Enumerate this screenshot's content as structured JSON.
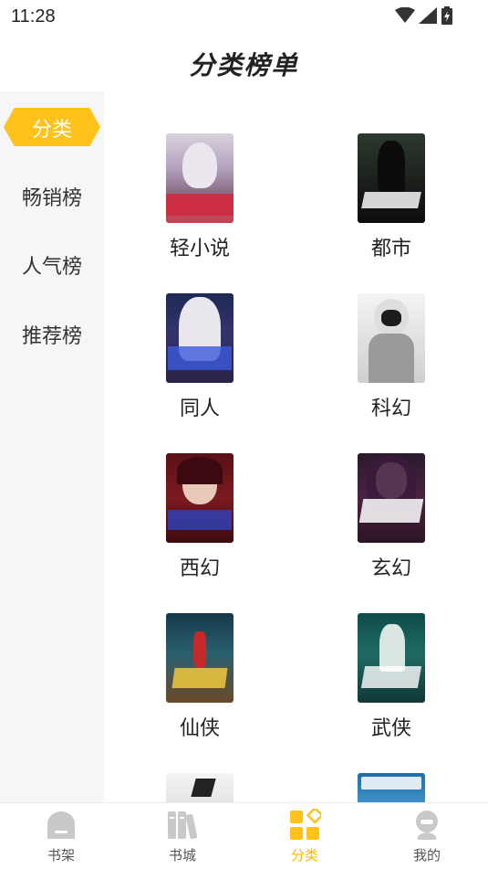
{
  "status": {
    "time": "11:28"
  },
  "header": {
    "title": "分类榜单"
  },
  "sidebar": {
    "items": [
      {
        "label": "分类",
        "active": true
      },
      {
        "label": "畅销榜",
        "active": false
      },
      {
        "label": "人气榜",
        "active": false
      },
      {
        "label": "推荐榜",
        "active": false
      }
    ]
  },
  "categories": [
    {
      "name": "轻小说",
      "cover": "anime-girl-cover"
    },
    {
      "name": "都市",
      "cover": "dark-warrior-cover"
    },
    {
      "name": "同人",
      "cover": "white-hair-girl-cover"
    },
    {
      "name": "科幻",
      "cover": "masked-figure-cover"
    },
    {
      "name": "西幻",
      "cover": "red-hair-girl-cover"
    },
    {
      "name": "玄幻",
      "cover": "purple-hair-girl-cover"
    },
    {
      "name": "仙侠",
      "cover": "mountain-hero-cover"
    },
    {
      "name": "武侠",
      "cover": "swordsman-cover"
    },
    {
      "name": "",
      "cover": "ink-landscape-cover"
    },
    {
      "name": "",
      "cover": "sky-city-cover"
    }
  ],
  "nav": {
    "items": [
      {
        "label": "书架",
        "icon": "bookshelf-icon",
        "active": false
      },
      {
        "label": "书城",
        "icon": "bookstore-icon",
        "active": false
      },
      {
        "label": "分类",
        "icon": "category-icon",
        "active": true
      },
      {
        "label": "我的",
        "icon": "profile-icon",
        "active": false
      }
    ]
  },
  "colors": {
    "accent": "#ffc21a",
    "sidebar_bg": "#f6f6f6"
  }
}
